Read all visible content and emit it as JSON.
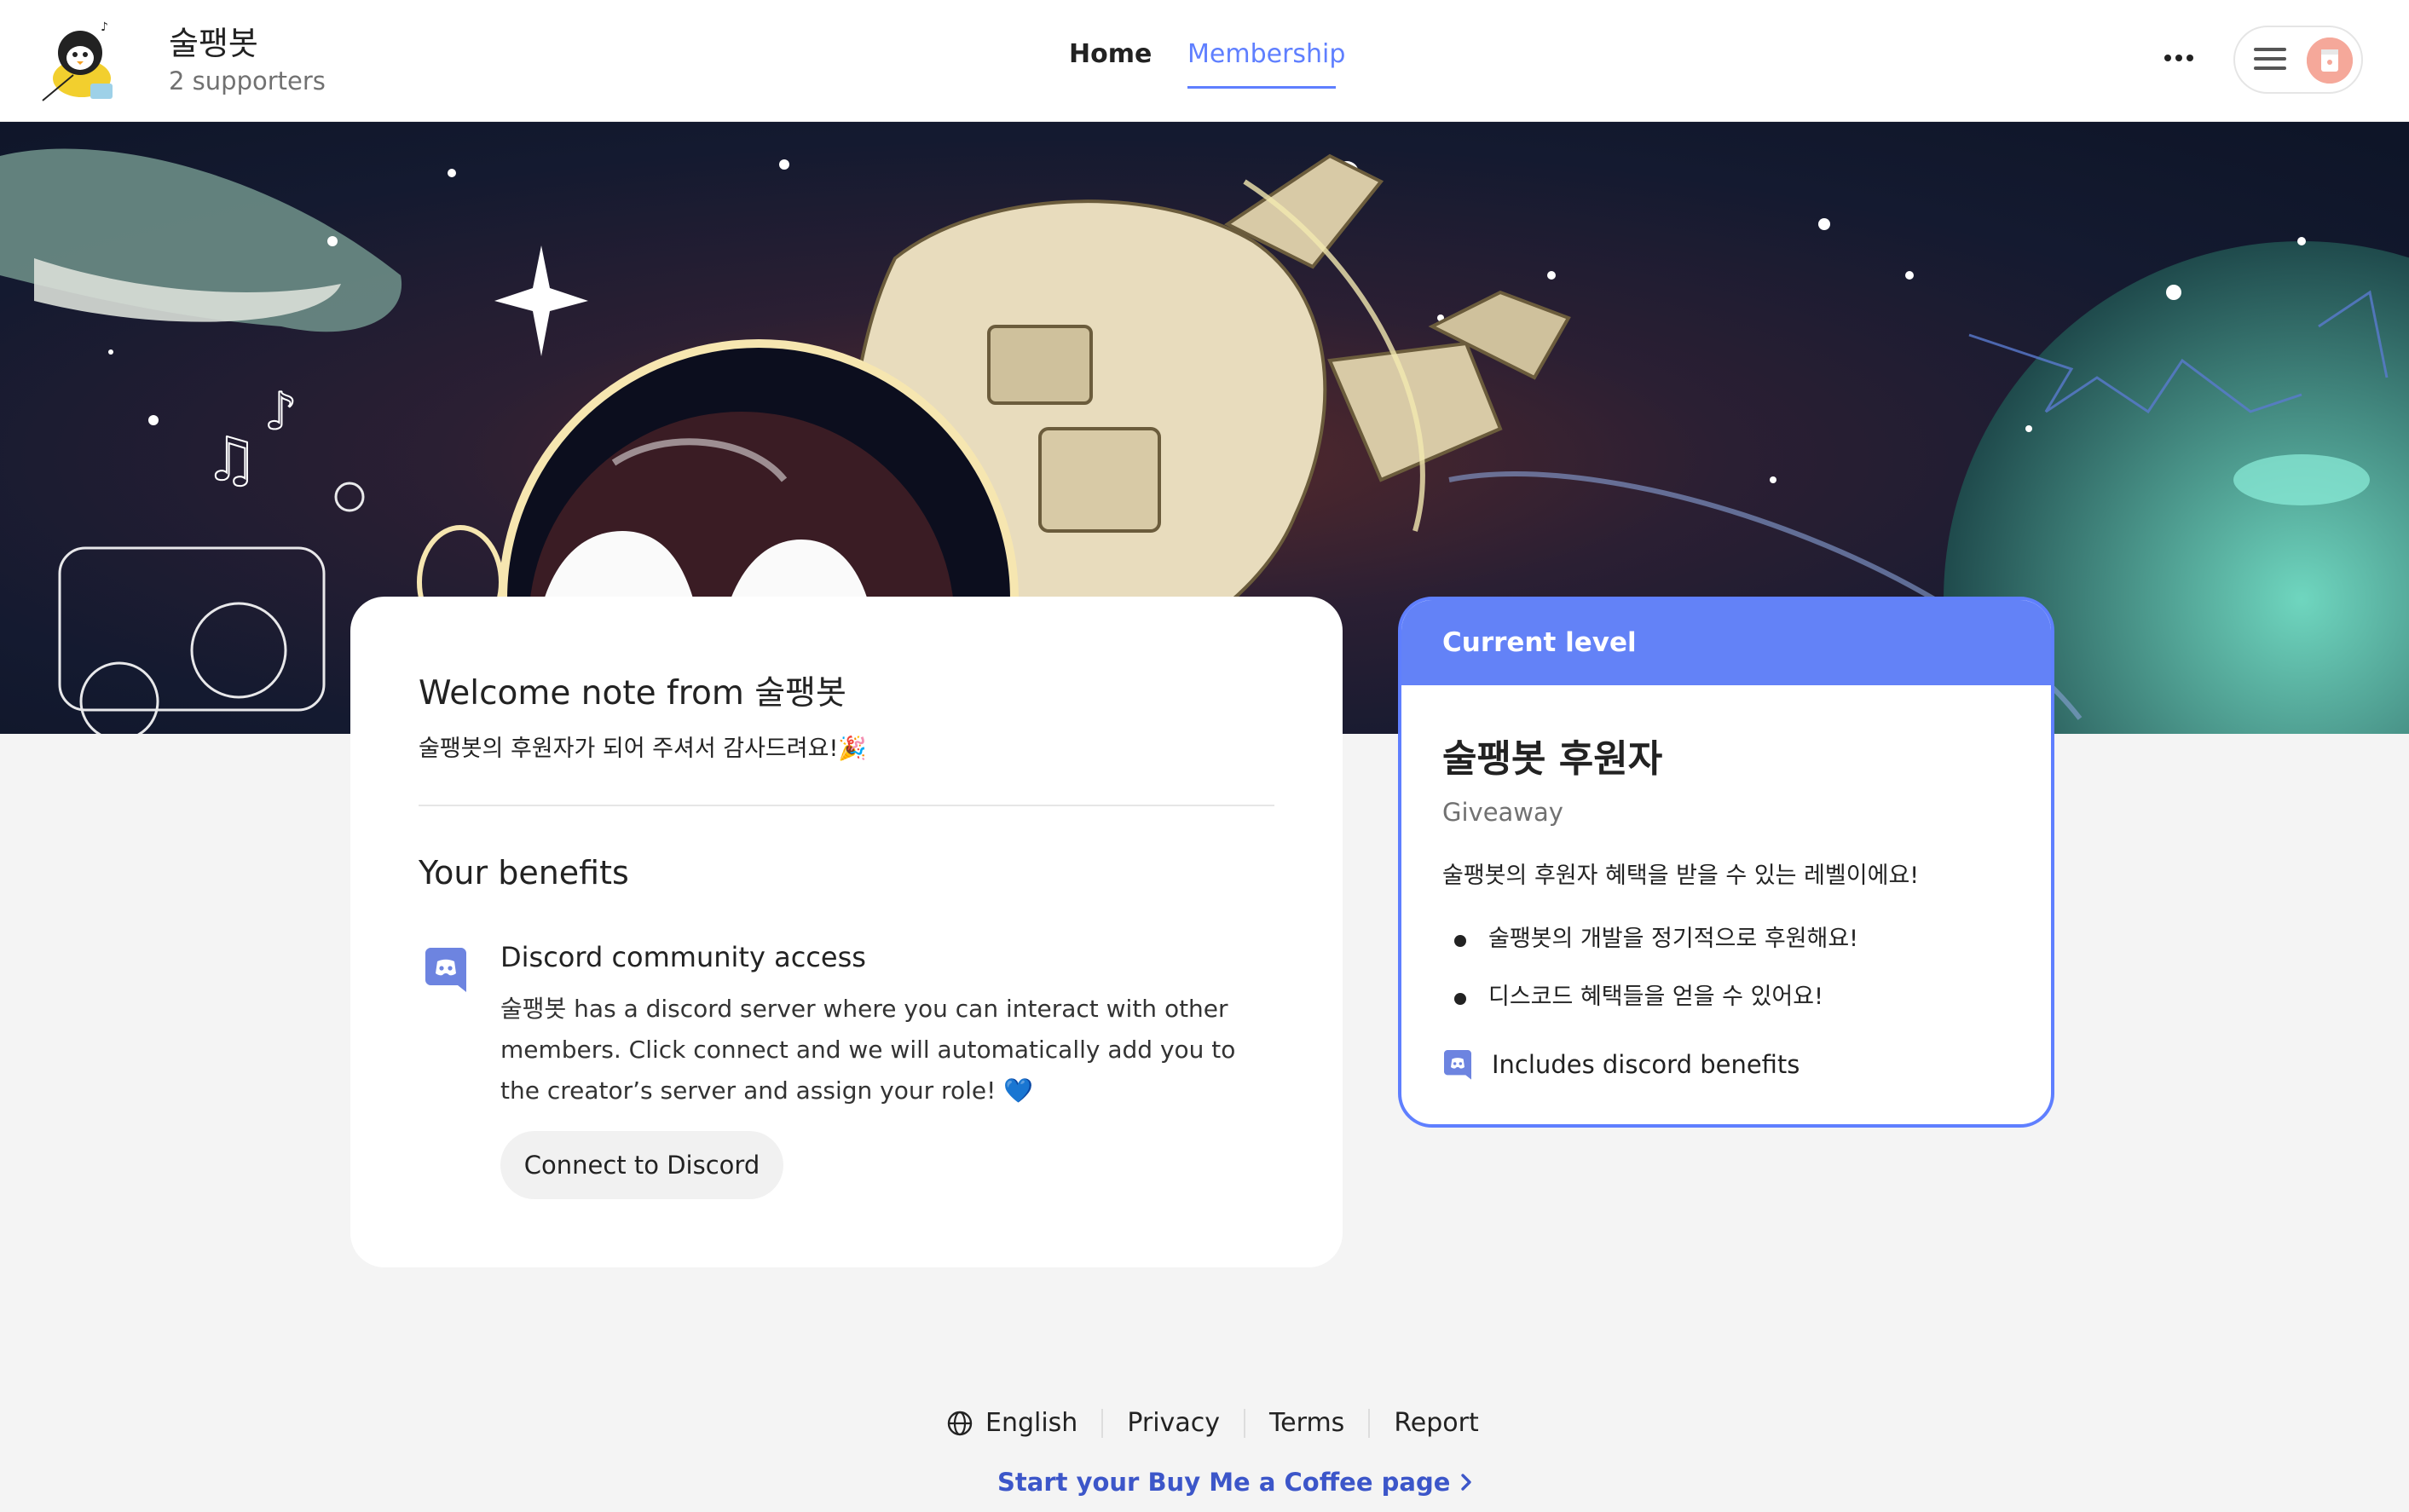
{
  "header": {
    "creator_name": "술팽봇",
    "supporters": "2 supporters",
    "nav": {
      "home": "Home",
      "membership": "Membership"
    },
    "active_tab": "Membership"
  },
  "welcome": {
    "title": "Welcome note from 술팽봇",
    "message": "술팽봇의 후원자가 되어 주셔서 감사드려요!🎉"
  },
  "benefits": {
    "title": "Your benefits",
    "items": [
      {
        "icon": "discord-icon",
        "title": "Discord community access",
        "description": "술팽봇 has a discord server where you can interact with other members. Click connect and we will automatically add you to the creator’s server and assign your role! 💙",
        "button_label": "Connect to Discord"
      }
    ]
  },
  "level": {
    "header": "Current level",
    "name": "술팽봇 후원자",
    "type": "Giveaway",
    "description": "술팽봇의 후원자 혜택을 받을 수 있는 레벨이에요!",
    "perks": [
      "술팽봇의 개발을 정기적으로 후원해요!",
      "디스코드 혜택들을 얻을 수 있어요!"
    ],
    "includes": "Includes discord benefits"
  },
  "footer": {
    "language": "English",
    "links": [
      "Privacy",
      "Terms",
      "Report"
    ],
    "cta": "Start your Buy Me a Coffee page"
  },
  "colors": {
    "accent": "#5f7fff",
    "level_header": "#6382f7",
    "cta": "#3c56c9",
    "page_bg": "#f4f4f4"
  }
}
